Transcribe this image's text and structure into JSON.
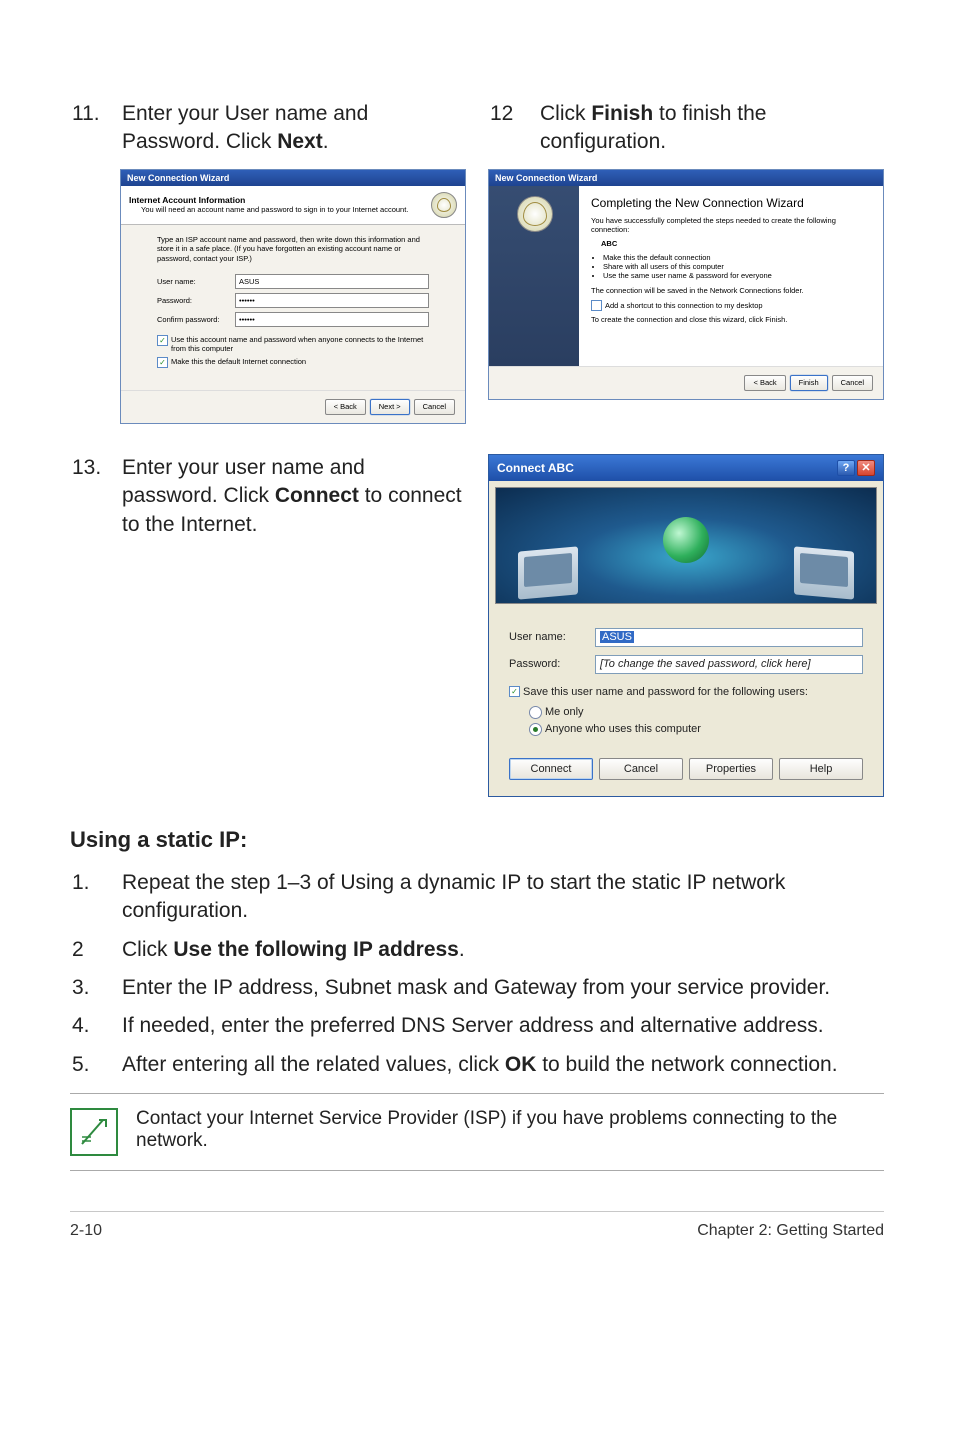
{
  "steps": {
    "s11": {
      "num": "11.",
      "text_a": "Enter your User name and Password. Click ",
      "bold": "Next",
      "text_b": "."
    },
    "s12": {
      "num": "12",
      "text_a": "Click ",
      "bold": "Finish",
      "text_b": " to finish the configuration."
    },
    "s13": {
      "num": "13.",
      "text_a": "Enter your user name and password. Click ",
      "bold": "Connect",
      "text_b": " to connect to the Internet."
    }
  },
  "wiz1": {
    "title": "New Connection Wizard",
    "hdr_title": "Internet Account Information",
    "hdr_sub": "You will need an account name and password to sign in to your Internet account.",
    "note": "Type an ISP account name and password, then write down this information and store it in a safe place. (If you have forgotten an existing account name or password, contact your ISP.)",
    "user_label": "User name:",
    "user_val": "ASUS",
    "pass_label": "Password:",
    "pass_val": "••••••",
    "conf_label": "Confirm password:",
    "conf_val": "••••••",
    "chk1": "Use this account name and password when anyone connects to the Internet from this computer",
    "chk2": "Make this the default Internet connection",
    "back": "< Back",
    "next": "Next >",
    "cancel": "Cancel"
  },
  "wiz2": {
    "title": "New Connection Wizard",
    "comp_title": "Completing the New Connection Wizard",
    "p1": "You have successfully completed the steps needed to create the following connection:",
    "conn_name": "ABC",
    "b1": "Make this the default connection",
    "b2": "Share with all users of this computer",
    "b3": "Use the same user name & password for everyone",
    "p2": "The connection will be saved in the Network Connections folder.",
    "chk": "Add a shortcut to this connection to my desktop",
    "p3": "To create the connection and close this wizard, click Finish.",
    "back": "< Back",
    "finish": "Finish",
    "cancel": "Cancel"
  },
  "conn": {
    "title": "Connect ABC",
    "user_label": "User name:",
    "user_val": "ASUS",
    "pass_label": "Password:",
    "pass_val": "[To change the saved password, click here]",
    "save_chk": "Save this user name and password for the following users:",
    "r1": "Me only",
    "r2": "Anyone who uses this computer",
    "connect": "Connect",
    "cancel": "Cancel",
    "props": "Properties",
    "help": "Help"
  },
  "static_ip": {
    "heading": "Using a static IP:",
    "items": [
      {
        "n": "1.",
        "t": "Repeat the step 1–3 of Using a dynamic IP to start the static IP network configuration."
      },
      {
        "n": "2",
        "t_a": "Click ",
        "bold": "Use the following IP address",
        "t_b": "."
      },
      {
        "n": "3.",
        "t": "Enter the IP address, Subnet mask and Gateway from your service provider."
      },
      {
        "n": "4.",
        "t": "If needed, enter the preferred DNS Server address and alternative address."
      },
      {
        "n": "5.",
        "t_a": "After entering all the related values, click ",
        "bold": "OK",
        "t_b": " to build the network connection."
      }
    ]
  },
  "note": "Contact your Internet Service Provider (ISP) if you have problems connecting to the network.",
  "footer": {
    "left": "2-10",
    "right": "Chapter 2: Getting Started"
  }
}
